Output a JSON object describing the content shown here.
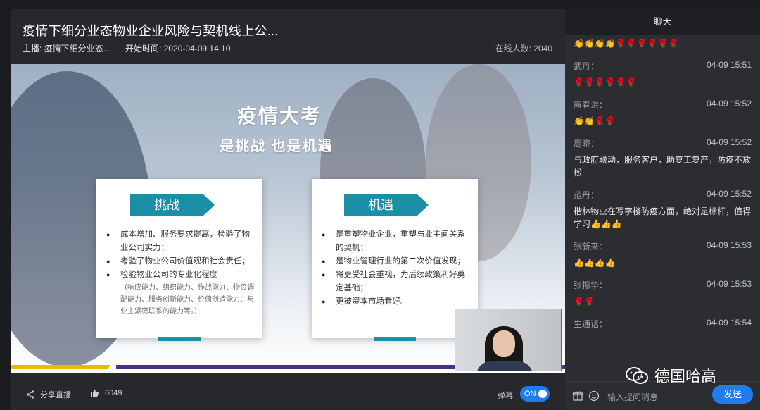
{
  "live": {
    "title": "疫情下细分业态物业企业风险与契机线上公...",
    "host_label": "主播: 疫情下细分业态...",
    "start_label": "开始时间: 2020-04-09 14:10",
    "online_label": "在线人数: 2040"
  },
  "slide": {
    "title": "疫情大考",
    "subtitle": "是挑战  也是机遇",
    "left_card": {
      "tag": "挑战",
      "items": [
        "成本增加、服务要求提高，检验了物业公司实力；",
        "考验了物业公司价值观和社会责任；",
        "检验物业公司的专业化程度"
      ],
      "note": "（响应能力、组织能力、作战能力、物资调配能力、服务创新能力、价值创造能力、与业主紧密联系的能力等。）"
    },
    "right_card": {
      "tag": "机遇",
      "items": [
        "是重塑物业企业，重塑与业主间关系的契机；",
        "是物业管理行业的第二次价值发现；",
        "将更受社会重视，为后续政策利好奠定基础；",
        "更被资本市场看好。"
      ]
    }
  },
  "footer": {
    "share_label": "分享直播",
    "like_count": "6049",
    "danmu_label": "弹幕",
    "toggle_label": "ON"
  },
  "chat": {
    "header": "聊天",
    "messages": [
      {
        "name": "",
        "time": "",
        "text": "👏👏👏👏🌹🌹🌹🌹🌹🌹"
      },
      {
        "name": "武丹：",
        "time": "04-09 15:51",
        "text": "🌹🌹🌹🌹🌹🌹"
      },
      {
        "name": "露春洪：",
        "time": "04-09 15:52",
        "text": "👏👏🌹🌹"
      },
      {
        "name": "周晓：",
        "time": "04-09 15:52",
        "text": "与政府联动，服务客户，助复工复产，防疫不放松"
      },
      {
        "name": "范丹：",
        "time": "04-09 15:52",
        "text": "楷林物业在写字楼防疫方面，绝对是标杆，值得学习👍👍👍"
      },
      {
        "name": "张新来：",
        "time": "04-09 15:53",
        "text": "👍👍👍👍"
      },
      {
        "name": "张振华：",
        "time": "04-09 15:53",
        "text": "🌹🌹"
      },
      {
        "name": "生通话：",
        "time": "04-09 15:54",
        "text": ""
      }
    ],
    "input_placeholder": "输入提问消息",
    "send_label": "发送"
  },
  "watermark": {
    "text": "德国哈高"
  },
  "colors": {
    "accent": "#1f7df0",
    "tag": "#1b8fa8",
    "stripe_yellow": "#f5b400",
    "stripe_purple": "#4a2f8c"
  }
}
